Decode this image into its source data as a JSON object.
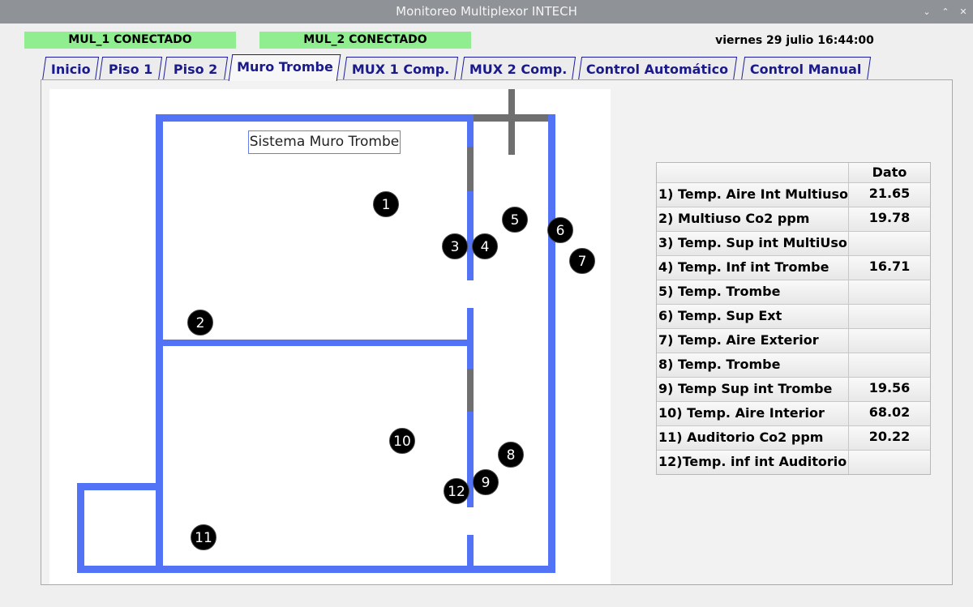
{
  "window": {
    "title": "Monitoreo Multiplexor INTECH",
    "buttons": {
      "collapse": "⌄",
      "expand": "⌃",
      "close": "✕"
    }
  },
  "status": {
    "mul1": "MUL_1 CONECTADO",
    "mul2": "MUL_2 CONECTADO",
    "datetime": "viernes 29 julio 16:44:00",
    "connected_color": "#90ee90"
  },
  "tabs": [
    {
      "label": "Inicio"
    },
    {
      "label": "Piso 1"
    },
    {
      "label": "Piso 2"
    },
    {
      "label": "Muro Trombe",
      "active": true
    },
    {
      "label": "MUX 1 Comp."
    },
    {
      "label": "MUX 2 Comp."
    },
    {
      "label": "Control Automático"
    },
    {
      "label": "Control Manual"
    }
  ],
  "diagram": {
    "title": "Sistema Muro Trombe",
    "wall_color": "#5273f5",
    "markers": [
      "1",
      "2",
      "3",
      "4",
      "5",
      "6",
      "7",
      "8",
      "9",
      "10",
      "11",
      "12"
    ]
  },
  "table": {
    "header": {
      "label": "",
      "value": "Dato"
    },
    "rows": [
      {
        "label": "1) Temp. Aire Int Multiuso",
        "value": "21.65"
      },
      {
        "label": "2) Multiuso Co2 ppm",
        "value": "19.78"
      },
      {
        "label": "3) Temp. Sup int MultiUso",
        "value": ""
      },
      {
        "label": "4) Temp. Inf int Trombe",
        "value": "16.71"
      },
      {
        "label": "5) Temp. Trombe",
        "value": ""
      },
      {
        "label": "6) Temp. Sup Ext",
        "value": ""
      },
      {
        "label": "7) Temp. Aire Exterior",
        "value": ""
      },
      {
        "label": "8) Temp. Trombe",
        "value": ""
      },
      {
        "label": "9) Temp Sup int Trombe",
        "value": "19.56"
      },
      {
        "label": "10) Temp. Aire Interior",
        "value": "68.02"
      },
      {
        "label": "11) Auditorio Co2 ppm",
        "value": "20.22"
      },
      {
        "label": "12)Temp. inf int Auditorio",
        "value": ""
      }
    ]
  }
}
